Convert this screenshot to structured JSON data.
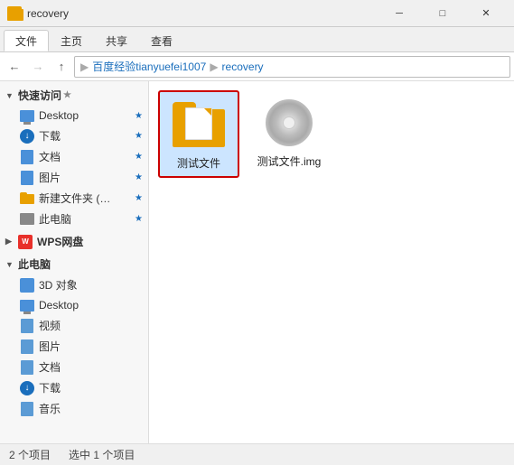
{
  "titlebar": {
    "title": "recovery",
    "min_label": "─",
    "max_label": "□",
    "close_label": "✕"
  },
  "ribbon": {
    "tabs": [
      "文件",
      "主页",
      "共享",
      "查看"
    ]
  },
  "nav": {
    "back_arrow": "←",
    "forward_arrow": "→",
    "up_arrow": "↑",
    "breadcrumb": [
      "百度经验tianyuefei1007",
      "recovery"
    ]
  },
  "sidebar": {
    "quick_access_label": "快速访问",
    "quick_access_items": [
      {
        "label": "Desktop",
        "pin": true
      },
      {
        "label": "下载",
        "pin": true
      },
      {
        "label": "文档",
        "pin": true
      },
      {
        "label": "图片",
        "pin": true
      },
      {
        "label": "新建文件夹 (…",
        "pin": true
      },
      {
        "label": "此电脑",
        "pin": true
      }
    ],
    "wps_label": "WPS网盘",
    "this_pc_label": "此电脑",
    "this_pc_items": [
      {
        "label": "3D 对象"
      },
      {
        "label": "Desktop"
      },
      {
        "label": "视频"
      },
      {
        "label": "图片"
      },
      {
        "label": "文档"
      },
      {
        "label": "下载"
      },
      {
        "label": "音乐"
      }
    ]
  },
  "content": {
    "items": [
      {
        "name": "测试文件",
        "type": "folder",
        "selected": true
      },
      {
        "name": "测试文件.img",
        "type": "disc",
        "selected": false
      }
    ]
  },
  "statusbar": {
    "count": "2 个项目",
    "selected": "选中 1 个项目"
  }
}
